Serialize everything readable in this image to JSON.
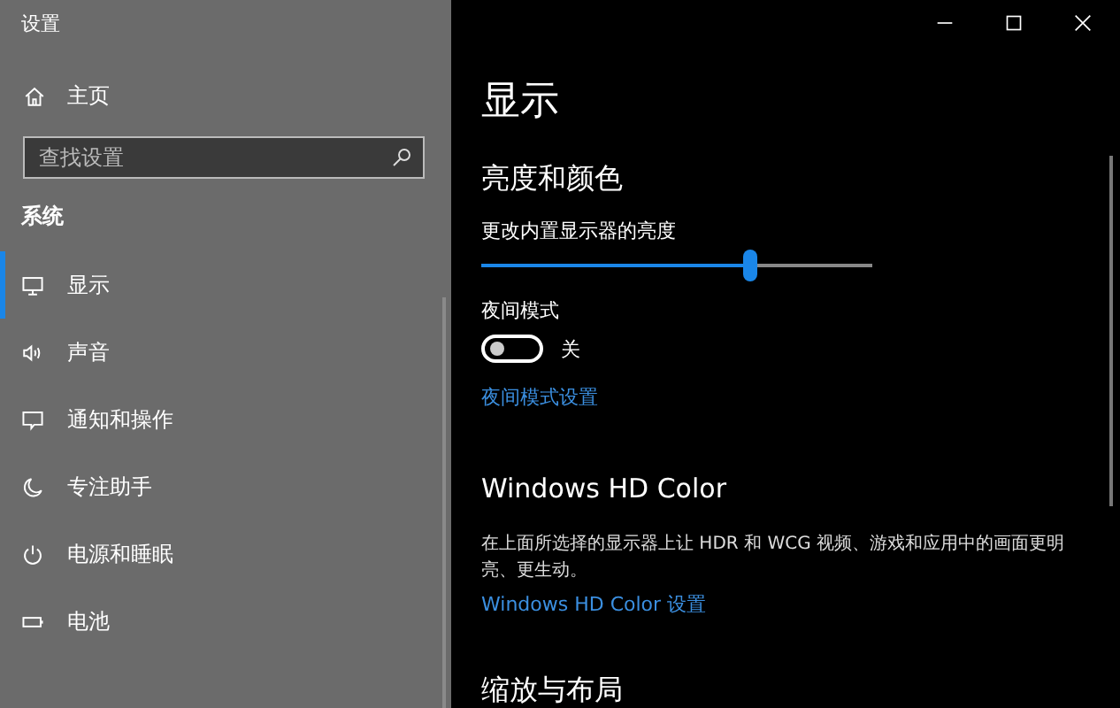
{
  "window": {
    "title": "设置"
  },
  "sidebar": {
    "home": "主页",
    "search": {
      "placeholder": "查找设置"
    },
    "section": "系统",
    "items": [
      {
        "label": "显示",
        "selected": true
      },
      {
        "label": "声音",
        "selected": false
      },
      {
        "label": "通知和操作",
        "selected": false
      },
      {
        "label": "专注助手",
        "selected": false
      },
      {
        "label": "电源和睡眠",
        "selected": false
      },
      {
        "label": "电池",
        "selected": false
      }
    ]
  },
  "page": {
    "title": "显示",
    "brightness_section": "亮度和颜色",
    "brightness": {
      "label": "更改内置显示器的亮度",
      "level": 0.69
    },
    "night_light": {
      "label": "夜间模式",
      "on": false,
      "state_text": "关",
      "link": "夜间模式设置"
    },
    "hd_color": {
      "title": "Windows HD Color",
      "description": "在上面所选择的显示器上让 HDR 和 WCG 视频、游戏和应用中的画面更明亮、更生动。",
      "link": "Windows HD Color 设置"
    },
    "next_section": "缩放与布局"
  }
}
